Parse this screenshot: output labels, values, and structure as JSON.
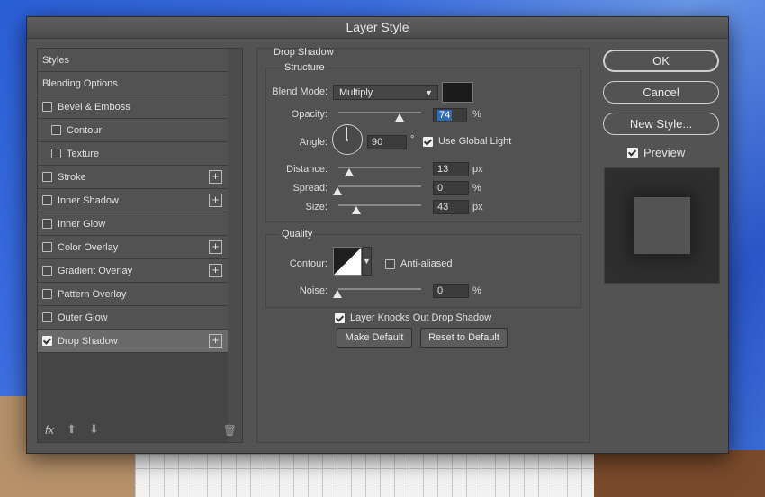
{
  "window": {
    "title": "Layer Style"
  },
  "styles_list": {
    "items": [
      {
        "label": "Styles",
        "checkbox": false,
        "checked": false,
        "indent": 0,
        "plus": false,
        "selected": false
      },
      {
        "label": "Blending Options",
        "checkbox": false,
        "checked": false,
        "indent": 0,
        "plus": false,
        "selected": false
      },
      {
        "label": "Bevel & Emboss",
        "checkbox": true,
        "checked": false,
        "indent": 0,
        "plus": false,
        "selected": false
      },
      {
        "label": "Contour",
        "checkbox": true,
        "checked": false,
        "indent": 1,
        "plus": false,
        "selected": false
      },
      {
        "label": "Texture",
        "checkbox": true,
        "checked": false,
        "indent": 1,
        "plus": false,
        "selected": false
      },
      {
        "label": "Stroke",
        "checkbox": true,
        "checked": false,
        "indent": 0,
        "plus": true,
        "selected": false
      },
      {
        "label": "Inner Shadow",
        "checkbox": true,
        "checked": false,
        "indent": 0,
        "plus": true,
        "selected": false
      },
      {
        "label": "Inner Glow",
        "checkbox": true,
        "checked": false,
        "indent": 0,
        "plus": false,
        "selected": false
      },
      {
        "label": "Color Overlay",
        "checkbox": true,
        "checked": false,
        "indent": 0,
        "plus": true,
        "selected": false
      },
      {
        "label": "Gradient Overlay",
        "checkbox": true,
        "checked": false,
        "indent": 0,
        "plus": true,
        "selected": false
      },
      {
        "label": "Pattern Overlay",
        "checkbox": true,
        "checked": false,
        "indent": 0,
        "plus": false,
        "selected": false
      },
      {
        "label": "Outer Glow",
        "checkbox": true,
        "checked": false,
        "indent": 0,
        "plus": false,
        "selected": false
      },
      {
        "label": "Drop Shadow",
        "checkbox": true,
        "checked": true,
        "indent": 0,
        "plus": true,
        "selected": true
      }
    ],
    "footer": {
      "fx": "fx",
      "up": "⬆",
      "down": "⬇",
      "trash": "🗑"
    }
  },
  "drop_shadow": {
    "title": "Drop Shadow",
    "structure": {
      "title": "Structure",
      "blend_mode_label": "Blend Mode:",
      "blend_mode_value": "Multiply",
      "shadow_color": "#1b1b1b",
      "opacity_label": "Opacity:",
      "opacity_value": "74",
      "opacity_unit": "%",
      "opacity_fraction": 0.74,
      "angle_label": "Angle:",
      "angle_value": "90",
      "angle_unit": "°",
      "use_global_light_label": "Use Global Light",
      "use_global_light": true,
      "distance_label": "Distance:",
      "distance_value": "13",
      "distance_unit": "px",
      "spread_label": "Spread:",
      "spread_value": "0",
      "spread_unit": "%",
      "size_label": "Size:",
      "size_value": "43",
      "size_unit": "px"
    },
    "quality": {
      "title": "Quality",
      "contour_label": "Contour:",
      "anti_aliased_label": "Anti-aliased",
      "anti_aliased": false,
      "noise_label": "Noise:",
      "noise_value": "0",
      "noise_unit": "%"
    },
    "knocks_out_label": "Layer Knocks Out Drop Shadow",
    "knocks_out": true,
    "make_default_label": "Make Default",
    "reset_default_label": "Reset to Default"
  },
  "actions": {
    "ok_label": "OK",
    "cancel_label": "Cancel",
    "new_style_label": "New Style...",
    "preview_label": "Preview",
    "preview_checked": true
  }
}
